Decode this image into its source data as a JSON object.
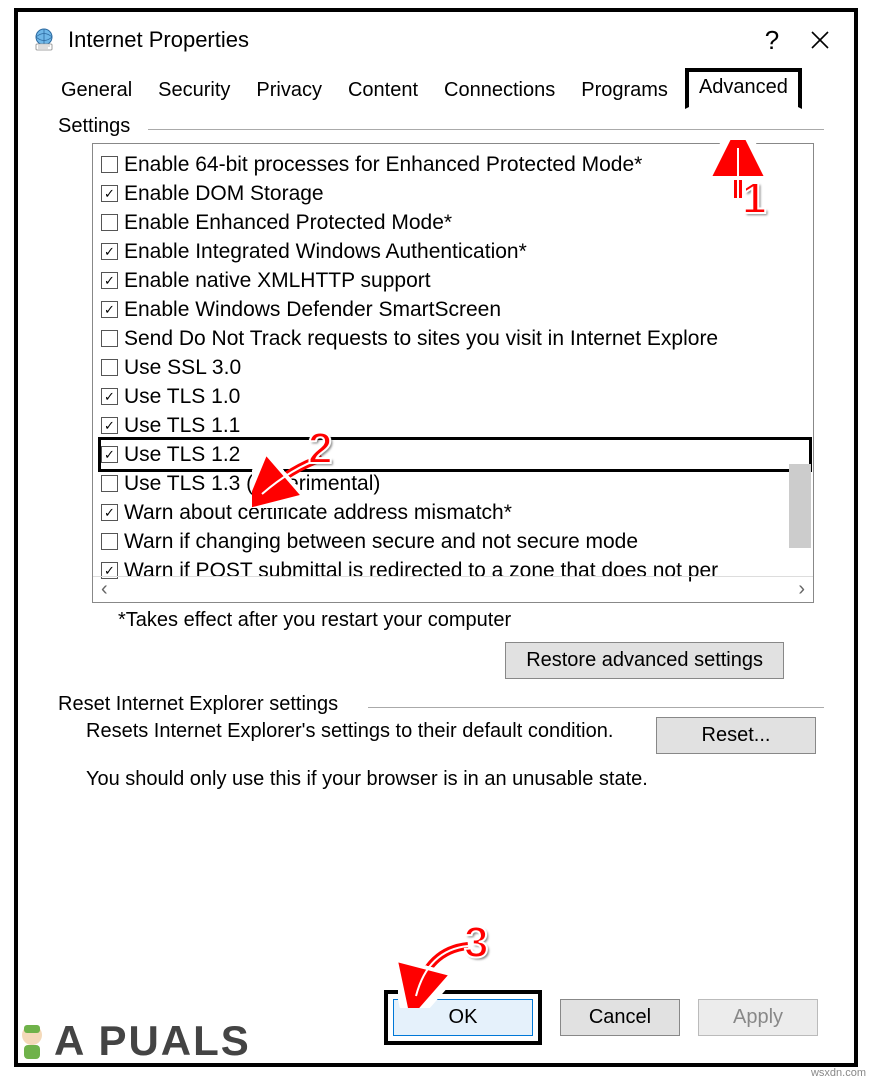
{
  "window": {
    "title": "Internet Properties",
    "help": "?",
    "close": "×"
  },
  "tabs": {
    "general": "General",
    "security": "Security",
    "privacy": "Privacy",
    "content": "Content",
    "connections": "Connections",
    "programs": "Programs",
    "advanced": "Advanced"
  },
  "settings": {
    "group_label": "Settings",
    "items": [
      {
        "label": "Enable 64-bit processes for Enhanced Protected Mode*",
        "checked": false
      },
      {
        "label": "Enable DOM Storage",
        "checked": true
      },
      {
        "label": "Enable Enhanced Protected Mode*",
        "checked": false
      },
      {
        "label": "Enable Integrated Windows Authentication*",
        "checked": true
      },
      {
        "label": "Enable native XMLHTTP support",
        "checked": true
      },
      {
        "label": "Enable Windows Defender SmartScreen",
        "checked": true
      },
      {
        "label": "Send Do Not Track requests to sites you visit in Internet Explore",
        "checked": false
      },
      {
        "label": "Use SSL 3.0",
        "checked": false
      },
      {
        "label": "Use TLS 1.0",
        "checked": true
      },
      {
        "label": "Use TLS 1.1",
        "checked": true
      },
      {
        "label": "Use TLS 1.2",
        "checked": true,
        "highlight": true
      },
      {
        "label": "Use TLS 1.3 (experimental)",
        "checked": false
      },
      {
        "label": "Warn about certificate address mismatch*",
        "checked": true
      },
      {
        "label": "Warn if changing between secure and not secure mode",
        "checked": false
      },
      {
        "label": "Warn if POST submittal is redirected to a zone that does not per",
        "checked": true
      }
    ],
    "footnote": "*Takes effect after you restart your computer",
    "restore_label": "Restore advanced settings"
  },
  "reset": {
    "group_label": "Reset Internet Explorer settings",
    "desc": "Resets Internet Explorer's settings to their default condition.",
    "button_label": "Reset...",
    "caution": "You should only use this if your browser is in an unusable state."
  },
  "buttons": {
    "ok": "OK",
    "cancel": "Cancel",
    "apply": "Apply"
  },
  "callouts": {
    "c1": "1",
    "c2": "2",
    "c3": "3"
  },
  "watermark": "A  PUALS",
  "site_credit": "wsxdn.com"
}
